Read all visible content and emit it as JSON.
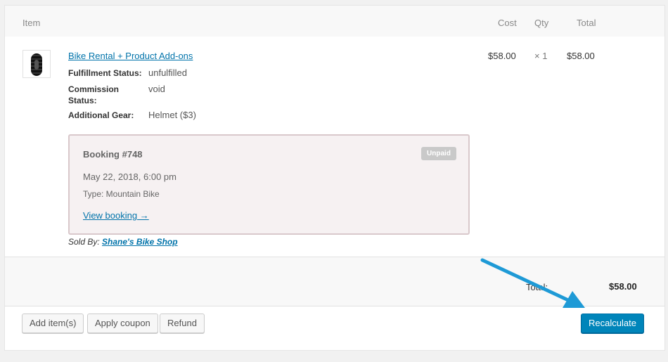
{
  "header": {
    "item": "Item",
    "cost": "Cost",
    "qty": "Qty",
    "total": "Total"
  },
  "line_item": {
    "name": "Bike Rental + Product Add-ons",
    "meta": [
      {
        "label": "Fulfillment Status:",
        "value": "unfulfilled"
      },
      {
        "label": "Commission Status:",
        "value": "void"
      },
      {
        "label": "Additional Gear:",
        "value": "Helmet ($3)"
      }
    ],
    "cost": "$58.00",
    "qty": "× 1",
    "total": "$58.00",
    "booking": {
      "title": "Booking #748",
      "status": "Unpaid",
      "date": "May 22, 2018, 6:00 pm",
      "type": "Type: Mountain Bike",
      "view_link": "View booking →"
    },
    "sold_by_label": "Sold By:",
    "sold_by_vendor": "Shane's Bike Shop"
  },
  "totals": {
    "label": "Total:",
    "value": "$58.00"
  },
  "actions": {
    "add_items": "Add item(s)",
    "apply_coupon": "Apply coupon",
    "refund": "Refund",
    "recalculate": "Recalculate"
  },
  "colors": {
    "accent": "#0085ba",
    "link": "#0073aa",
    "annotation_arrow": "#1e9ad6",
    "booking_bg": "#f6f1f2",
    "badge": "#c9c9c9"
  }
}
